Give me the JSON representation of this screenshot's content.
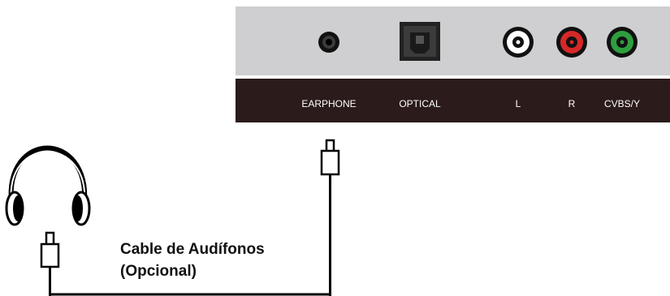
{
  "panel": {
    "ports": [
      {
        "id": "earphone",
        "label": "EARPHONE"
      },
      {
        "id": "optical",
        "label": "OPTICAL"
      },
      {
        "id": "l",
        "label": "L"
      },
      {
        "id": "r",
        "label": "R"
      },
      {
        "id": "cvbs",
        "label": "CVBS/Y"
      }
    ]
  },
  "caption": {
    "line1": "Cable de Audífonos",
    "line2": "(Opcional)"
  },
  "colors": {
    "panel_top": "#cfcfd1",
    "panel_bottom": "#2b1b1a",
    "rca_white": "#ffffff",
    "rca_red": "#d62828",
    "rca_green": "#2e9e3e"
  }
}
